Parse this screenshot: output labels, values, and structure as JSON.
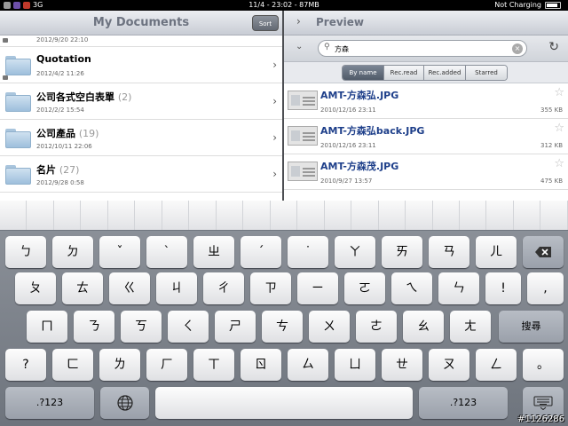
{
  "status_bar": {
    "carrier": "3G",
    "center": "11/4 - 23:02 - 87MB",
    "battery": "Not Charging"
  },
  "documents": {
    "title": "My Documents",
    "sort_label": "Sort",
    "partial_date": "2012/9/20 22:10",
    "items": [
      {
        "name": "Quotation",
        "count": "",
        "date": "2012/4/2 11:26"
      },
      {
        "name": "公司各式空白表單",
        "count": "(2)",
        "date": "2012/2/2 15:54"
      },
      {
        "name": "公司產品",
        "count": "(19)",
        "date": "2012/10/11 22:06"
      },
      {
        "name": "名片",
        "count": "(27)",
        "date": "2012/9/28 0:58"
      }
    ]
  },
  "preview": {
    "title": "Preview",
    "search_value": "方森",
    "tabs": [
      "By name",
      "Rec.read",
      "Rec.added",
      "Starred"
    ],
    "selected_tab": "By name",
    "files": [
      {
        "name": "AMT-方森弘.JPG",
        "date": "2010/12/16 23:11",
        "size": "355 KB"
      },
      {
        "name": "AMT-方森弘back.JPG",
        "date": "2010/12/16 23:11",
        "size": "312 KB"
      },
      {
        "name": "AMT-方森茂.JPG",
        "date": "2010/9/27 13:57",
        "size": "475 KB"
      }
    ]
  },
  "keyboard": {
    "row1": [
      "ㄅ",
      "ㄉ",
      "ˇ",
      "ˋ",
      "ㄓ",
      "ˊ",
      "˙",
      "ㄚ",
      "ㄞ",
      "ㄢ",
      "ㄦ"
    ],
    "row2": [
      "ㄆ",
      "ㄊ",
      "ㄍ",
      "ㄐ",
      "ㄔ",
      "ㄗ",
      "ㄧ",
      "ㄛ",
      "ㄟ",
      "ㄣ",
      "!",
      ","
    ],
    "row3": [
      "ㄇ",
      "ㄋ",
      "ㄎ",
      "ㄑ",
      "ㄕ",
      "ㄘ",
      "ㄨ",
      "ㄜ",
      "ㄠ",
      "ㄤ"
    ],
    "row4": [
      "?",
      "ㄈ",
      "ㄌ",
      "ㄏ",
      "ㄒ",
      "ㄖ",
      "ㄙ",
      "ㄩ",
      "ㄝ",
      "ㄡ",
      "ㄥ",
      "。"
    ],
    "search_key": "搜尋",
    "numbers_key": ".?123",
    "globe_icon": "globe-icon",
    "hide_icon": "keyboard-hide-icon",
    "delete_icon": "backspace-icon"
  },
  "watermark": "#1126286"
}
